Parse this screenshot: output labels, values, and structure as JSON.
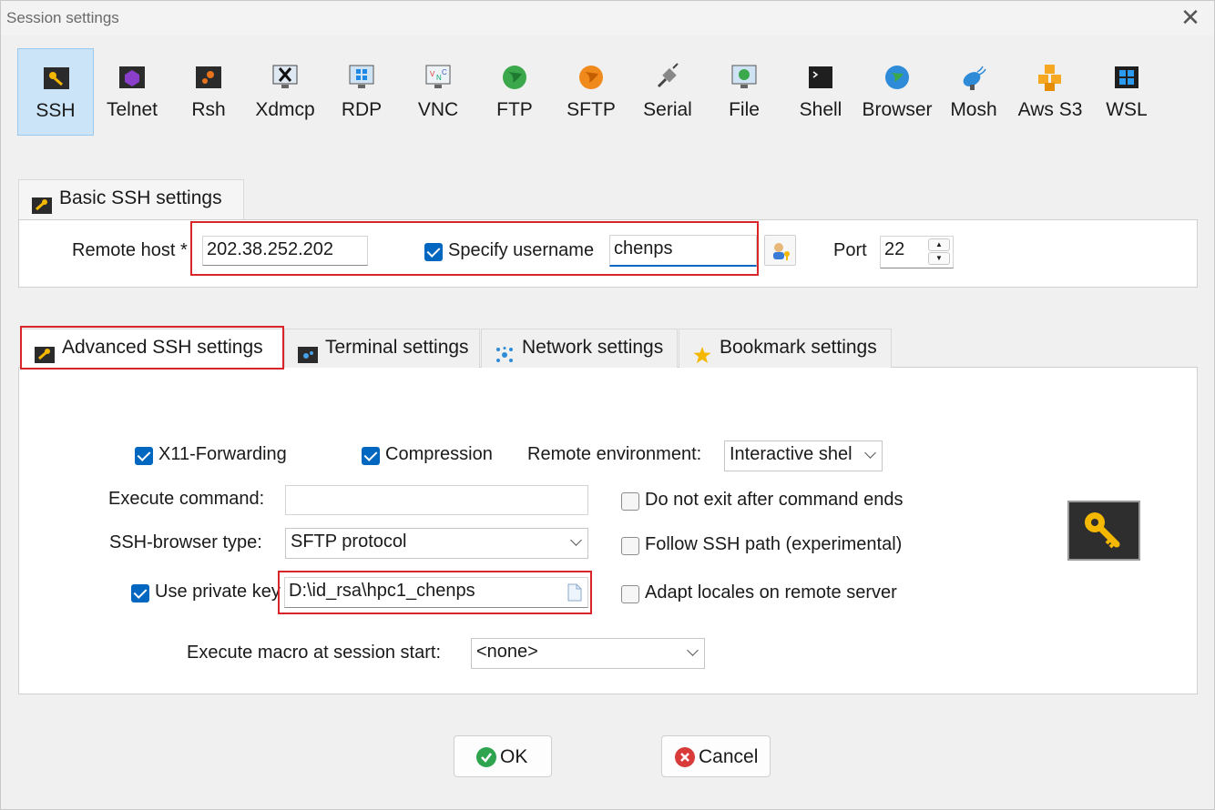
{
  "window": {
    "title": "Session settings",
    "close_glyph": "✕"
  },
  "session_types": [
    {
      "label": "SSH",
      "icon": "key-icon",
      "selected": true
    },
    {
      "label": "Telnet",
      "icon": "telnet-icon"
    },
    {
      "label": "Rsh",
      "icon": "rsh-icon"
    },
    {
      "label": "Xdmcp",
      "icon": "xdmcp-icon"
    },
    {
      "label": "RDP",
      "icon": "rdp-icon"
    },
    {
      "label": "VNC",
      "icon": "vnc-icon"
    },
    {
      "label": "FTP",
      "icon": "ftp-globe-icon"
    },
    {
      "label": "SFTP",
      "icon": "sftp-globe-icon"
    },
    {
      "label": "Serial",
      "icon": "serial-plug-icon"
    },
    {
      "label": "File",
      "icon": "file-monitor-icon"
    },
    {
      "label": "Shell",
      "icon": "shell-terminal-icon"
    },
    {
      "label": "Browser",
      "icon": "browser-globe-icon"
    },
    {
      "label": "Mosh",
      "icon": "mosh-satellite-icon"
    },
    {
      "label": "Aws S3",
      "icon": "aws-cubes-icon"
    },
    {
      "label": "WSL",
      "icon": "windows-logo-icon"
    }
  ],
  "basic": {
    "tab_label": "Basic SSH settings",
    "remote_host_label": "Remote host *",
    "remote_host_value": "202.38.252.202",
    "specify_username_label": "Specify username",
    "specify_username_checked": true,
    "username_value": "chenps",
    "port_label": "Port",
    "port_value": "22"
  },
  "tabs": [
    {
      "label": "Advanced SSH settings",
      "icon": "wrench-icon",
      "active": true
    },
    {
      "label": "Terminal settings",
      "icon": "terminal-settings-icon"
    },
    {
      "label": "Network settings",
      "icon": "network-icon"
    },
    {
      "label": "Bookmark settings",
      "icon": "star-icon"
    }
  ],
  "advanced": {
    "x11_label": "X11-Forwarding",
    "x11_checked": true,
    "compression_label": "Compression",
    "compression_checked": true,
    "remote_env_label": "Remote environment:",
    "remote_env_value": "Interactive shel",
    "exec_cmd_label": "Execute command:",
    "exec_cmd_value": "",
    "no_exit_label": "Do not exit after command ends",
    "no_exit_checked": false,
    "browser_type_label": "SSH-browser type:",
    "browser_type_value": "SFTP protocol",
    "follow_path_label": "Follow SSH path (experimental)",
    "follow_path_checked": false,
    "private_key_label": "Use private key",
    "private_key_checked": true,
    "private_key_value": "D:\\id_rsa\\hpc1_chenps",
    "adapt_locales_label": "Adapt locales on remote server",
    "adapt_locales_checked": false,
    "macro_label": "Execute macro at session start:",
    "macro_value": "<none>"
  },
  "buttons": {
    "ok": "OK",
    "cancel": "Cancel"
  },
  "colors": {
    "accent": "#0067c0",
    "highlight_box": "#d7252a",
    "selected_bg": "#cce4f7"
  }
}
